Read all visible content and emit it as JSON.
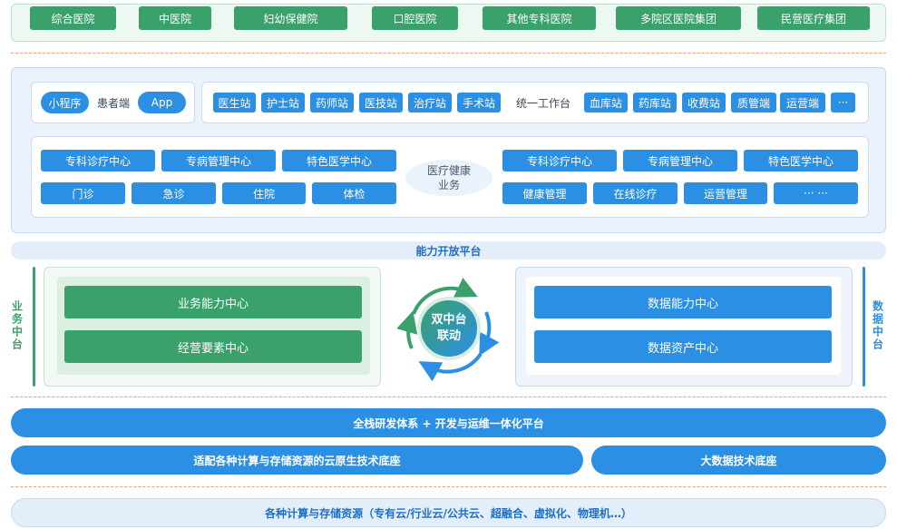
{
  "top_row": {
    "items": [
      "综合医院",
      "中医院",
      "妇幼保健院",
      "口腔医院",
      "其他专科医院",
      "多院区医院集团",
      "民营医疗集团"
    ]
  },
  "front": {
    "mini_program": "小程序",
    "patient_end": "患者端",
    "app": "App",
    "stations_left": [
      "医生站",
      "护士站",
      "药师站",
      "医技站",
      "治疗站",
      "手术站"
    ],
    "workbench": "统一工作台",
    "stations_right": [
      "血库站",
      "药库站",
      "收费站",
      "质管端",
      "运营端",
      "···"
    ],
    "left_top": [
      "专科诊疗中心",
      "专病管理中心",
      "特色医学中心"
    ],
    "left_bottom": [
      "门诊",
      "急诊",
      "住院",
      "体检"
    ],
    "center_line1": "医疗健康",
    "center_line2": "业务",
    "right_top": [
      "专科诊疗中心",
      "专病管理中心",
      "特色医学中心"
    ],
    "right_bottom": [
      "健康管理",
      "在线诊疗",
      "运营管理",
      "··· ···"
    ]
  },
  "capability_bar": "能力开放平台",
  "middle": {
    "left_side_label": "业务中台",
    "right_side_label": "数据中台",
    "biz_capability": "业务能力中心",
    "ops_elements": "经营要素中心",
    "hub_line1": "双中台",
    "hub_line2": "联动",
    "data_capability": "数据能力中心",
    "data_assets": "数据资产中心"
  },
  "bottom": {
    "devops": "全栈研发体系 + 开发与运维一体化平台",
    "cloud_native": "适配各种计算与存储资源的云原生技术底座",
    "big_data": "大数据技术底座",
    "resources": "各种计算与存储资源（专有云/行业云/公共云、超融合、虚拟化、物理机…）"
  },
  "colors": {
    "green": "#3aa16b",
    "blue": "#2b8fe3",
    "dash": "#f2a06b",
    "cap_text": "#1f6fc4"
  }
}
